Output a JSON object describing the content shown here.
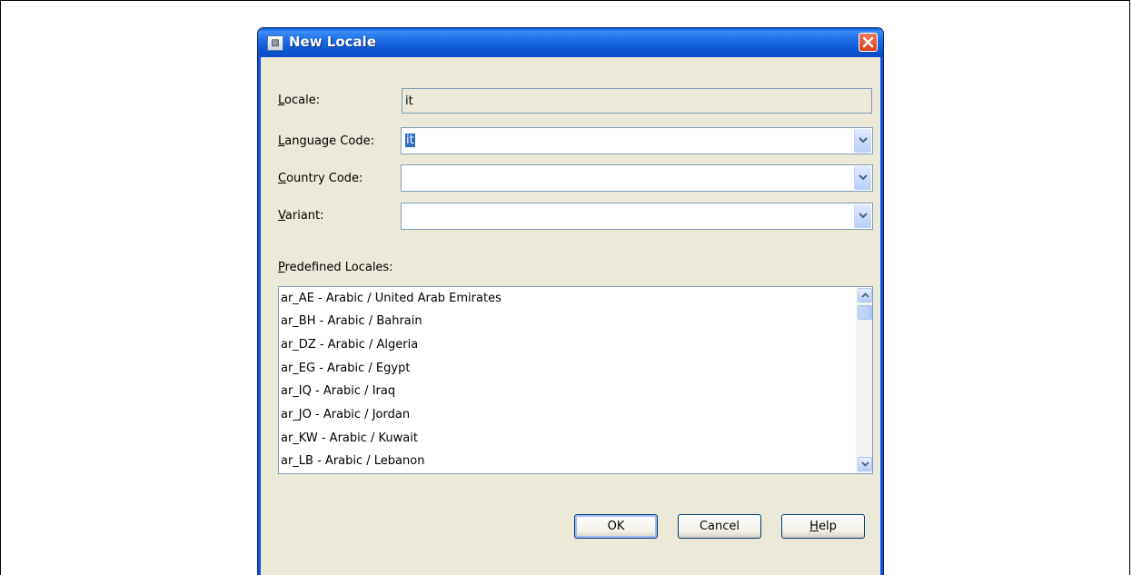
{
  "dialog": {
    "title": "New Locale",
    "icon": "app-icon",
    "close_icon": "close-icon"
  },
  "fields": {
    "locale": {
      "label_mn": "L",
      "label_rest": "ocale:",
      "value": "it"
    },
    "language_code": {
      "label_mn": "L",
      "label_rest": "anguage Code:",
      "value": "it"
    },
    "country_code": {
      "label_pre": "",
      "label_mn": "C",
      "label_rest": "ountry Code:",
      "value": ""
    },
    "variant": {
      "label_mn": "V",
      "label_rest": "ariant:",
      "value": ""
    }
  },
  "predefined": {
    "label_mn": "P",
    "label_rest": "redefined Locales:",
    "items": [
      "ar_AE - Arabic / United Arab Emirates",
      "ar_BH - Arabic / Bahrain",
      "ar_DZ - Arabic / Algeria",
      "ar_EG - Arabic / Egypt",
      "ar_IQ - Arabic / Iraq",
      "ar_JO - Arabic / Jordan",
      "ar_KW - Arabic / Kuwait",
      "ar_LB - Arabic / Lebanon"
    ]
  },
  "buttons": {
    "ok": "OK",
    "cancel": "Cancel",
    "help_mn": "H",
    "help_rest": "elp"
  },
  "colors": {
    "titlebar": "#0b56d0",
    "dialog_bg": "#ece9d8",
    "selection": "#316ac5",
    "close": "#d6431c"
  }
}
